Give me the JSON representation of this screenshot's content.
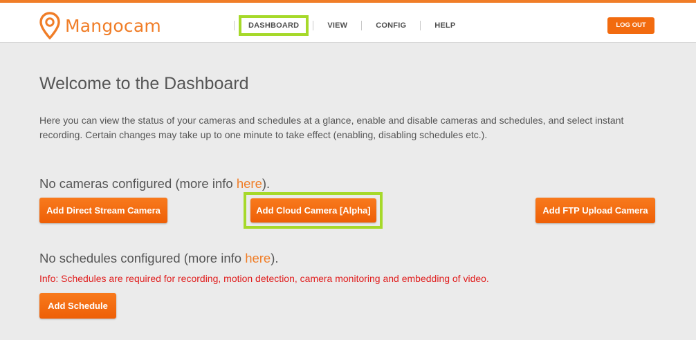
{
  "colors": {
    "accent": "#f07d27",
    "button": "#f26b0f",
    "highlight": "#a6d92a",
    "info": "#e01e1e"
  },
  "header": {
    "logo_text": "Mangocam",
    "logo_icon": "location-pin-icon",
    "nav": [
      "DASHBOARD",
      "VIEW",
      "CONFIG",
      "HELP"
    ],
    "active_nav": "DASHBOARD",
    "logout_label": "LOG OUT"
  },
  "main": {
    "title": "Welcome to the Dashboard",
    "intro": "Here you can view the status of your cameras and schedules at a glance, enable and disable cameras and schedules, and select instant recording. Certain changes may take up to one minute to take effect (enabling, disabling schedules etc.).",
    "cameras": {
      "status_prefix": "No cameras configured (more info ",
      "link": "here",
      "status_suffix": ").",
      "buttons": [
        "Add Direct Stream Camera",
        "Add Cloud Camera [Alpha]",
        "Add FTP Upload Camera"
      ]
    },
    "schedules": {
      "status_prefix": "No schedules configured (more info ",
      "link": "here",
      "status_suffix": ").",
      "info": "Info: Schedules are required for recording, motion detection, camera monitoring and embedding of video.",
      "button": "Add Schedule"
    }
  }
}
